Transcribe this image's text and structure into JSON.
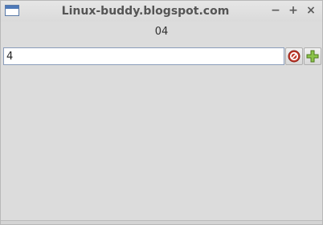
{
  "window": {
    "title": "Linux-buddy.blogspot.com",
    "minimize_glyph": "−",
    "maximize_glyph": "+",
    "close_glyph": "×"
  },
  "content": {
    "label_text": "04",
    "entry_value": "4"
  },
  "icons": {
    "app": "window-icon",
    "clear": "clear-icon",
    "add": "add-icon"
  },
  "colors": {
    "clear_icon_red": "#c0392b",
    "add_icon_green": "#8bc34a"
  }
}
